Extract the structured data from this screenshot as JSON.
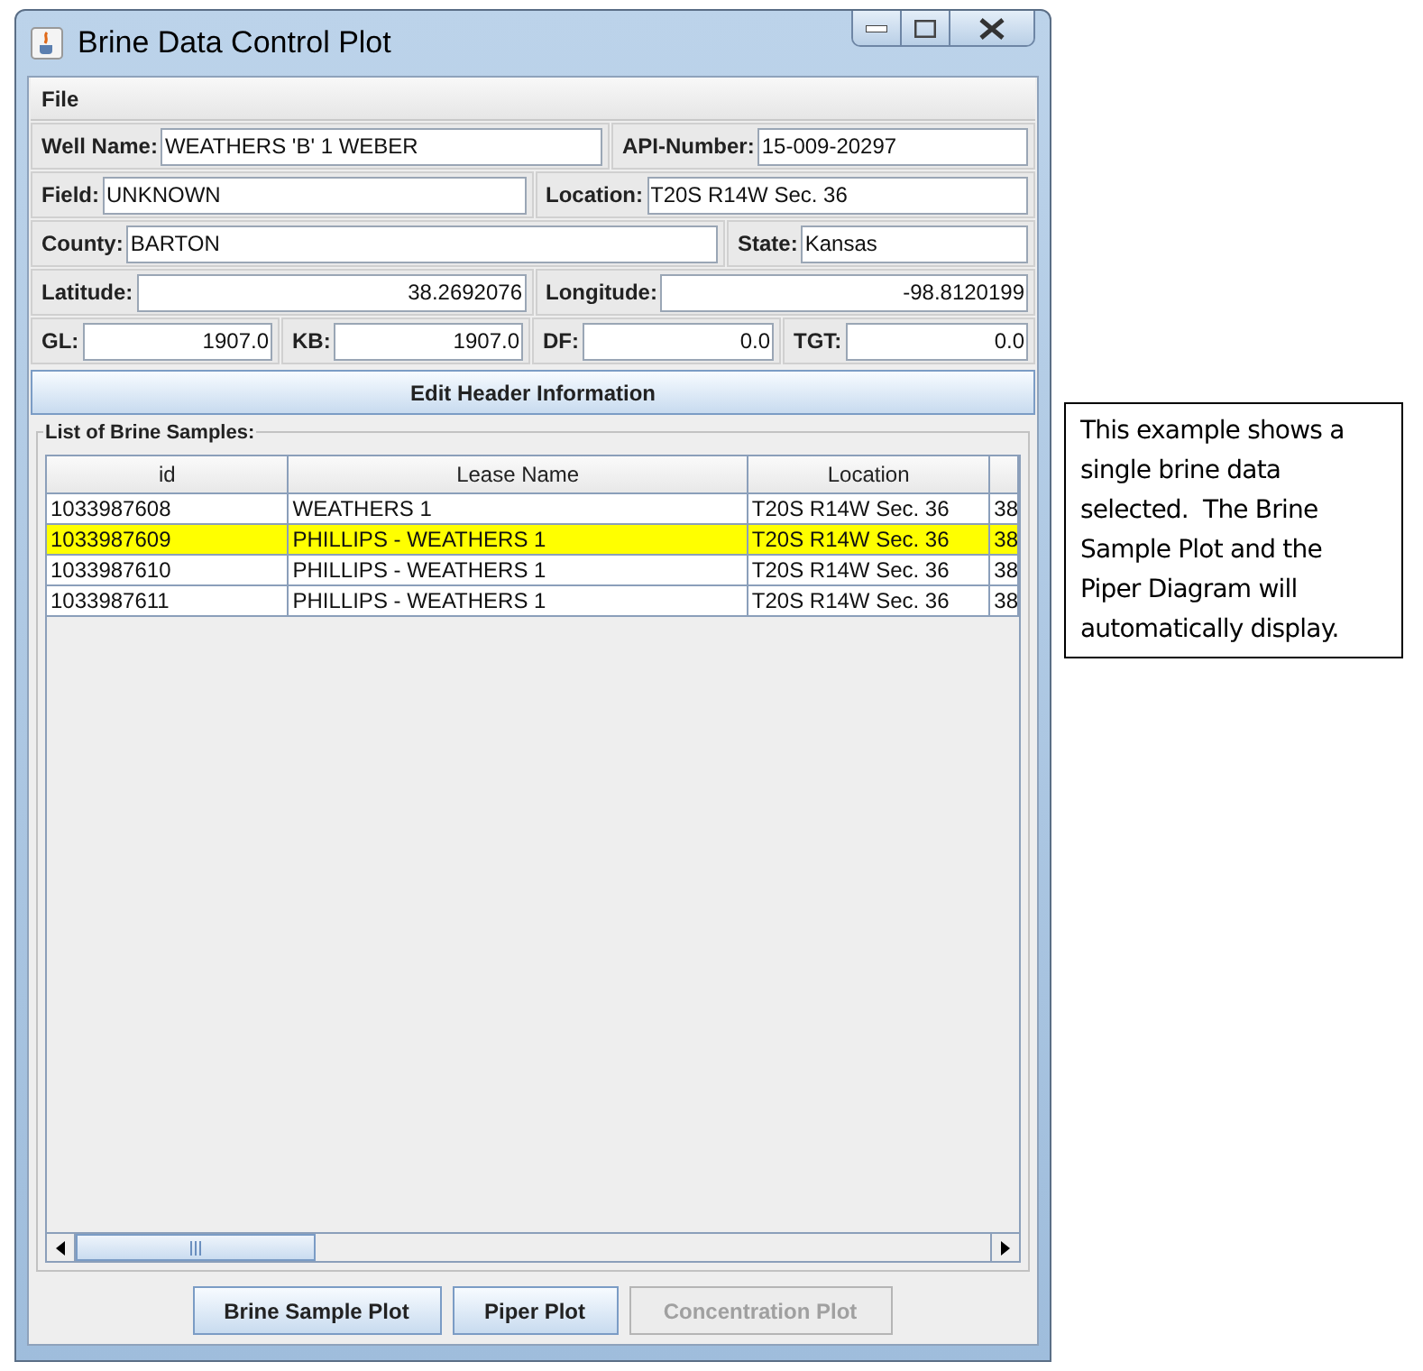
{
  "window": {
    "title": "Brine Data Control Plot"
  },
  "menu": [
    "File"
  ],
  "header_rows": [
    [
      {
        "label": "Well Name:",
        "value": "WEATHERS 'B' 1 WEBER",
        "kind": "text"
      },
      {
        "label": "API-Number:",
        "value": "15-009-20297",
        "kind": "text"
      }
    ],
    [
      {
        "label": "Field:",
        "value": "UNKNOWN",
        "kind": "text"
      },
      {
        "label": "Location:",
        "value": "T20S R14W Sec. 36",
        "kind": "text"
      }
    ],
    [
      {
        "label": "County:",
        "value": "BARTON",
        "kind": "text"
      },
      {
        "label": "State:",
        "value": "Kansas",
        "kind": "text"
      }
    ],
    [
      {
        "label": "Latitude:",
        "value": "38.2692076",
        "kind": "number"
      },
      {
        "label": "Longitude:",
        "value": "-98.8120199",
        "kind": "number"
      }
    ],
    [
      {
        "label": "GL:",
        "value": "1907.0",
        "kind": "number"
      },
      {
        "label": "KB:",
        "value": "1907.0",
        "kind": "number"
      },
      {
        "label": "DF:",
        "value": "0.0",
        "kind": "number"
      },
      {
        "label": "TGT:",
        "value": "0.0",
        "kind": "number"
      }
    ]
  ],
  "edit_button": "Edit Header Information",
  "samples": {
    "title": "List of Brine Samples:",
    "columns": [
      "id",
      "Lease Name",
      "Location"
    ],
    "rows": [
      {
        "cells": [
          "1033987608",
          "WEATHERS 1",
          "T20S R14W Sec. 36",
          "38"
        ],
        "selected": false
      },
      {
        "cells": [
          "1033987609",
          "PHILLIPS - WEATHERS 1",
          "T20S R14W Sec. 36",
          "38"
        ],
        "selected": true
      },
      {
        "cells": [
          "1033987610",
          "PHILLIPS - WEATHERS 1",
          "T20S R14W Sec. 36",
          "38"
        ],
        "selected": false
      },
      {
        "cells": [
          "1033987611",
          "PHILLIPS - WEATHERS 1",
          "T20S R14W Sec. 36",
          "38"
        ],
        "selected": false
      }
    ]
  },
  "buttons": [
    {
      "label": "Brine Sample Plot",
      "disabled": false
    },
    {
      "label": "Piper Plot",
      "disabled": false
    },
    {
      "label": "Concentration Plot",
      "disabled": true
    }
  ],
  "note": "This example shows a single brine data selected.  The Brine Sample Plot and the Piper Diagram will automatically display."
}
